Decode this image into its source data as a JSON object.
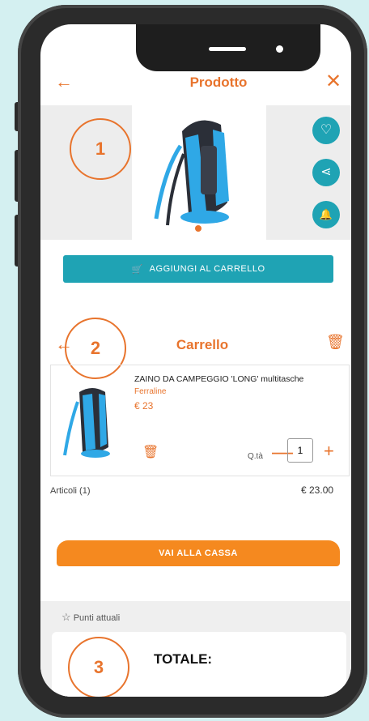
{
  "header": {
    "title": "Prodotto",
    "back_icon": "←",
    "close_icon": "✕"
  },
  "product": {
    "annotation": "1",
    "favorite_icon": "♡",
    "share_icon": "⋖",
    "bell_icon": "🔔"
  },
  "add_to_cart": {
    "label": "AGGIUNGI AL CARRELLO",
    "cart_icon": "🛒"
  },
  "cart": {
    "title": "Carrello",
    "annotation": "2",
    "back_icon": "←",
    "trash_icon": "🗑",
    "item": {
      "name": "ZAINO DA CAMPEGGIO 'LONG' multitasche",
      "brand": "Ferraline",
      "price": "€ 23",
      "qty_label": "Q.tà",
      "qty": "1",
      "minus": "—",
      "plus": "+"
    }
  },
  "summary": {
    "articles_label": "Articoli (1)",
    "articles_price": "€ 23.00"
  },
  "checkout": {
    "label": "VAI ALLA CASSA"
  },
  "points": {
    "label": "Punti attuali",
    "star_icon": "☆",
    "annotation": "3",
    "total_label": "TOTALE:"
  },
  "colors": {
    "accent": "#e8742d",
    "teal": "#1fa3b4",
    "orange_button": "#f5891f"
  }
}
